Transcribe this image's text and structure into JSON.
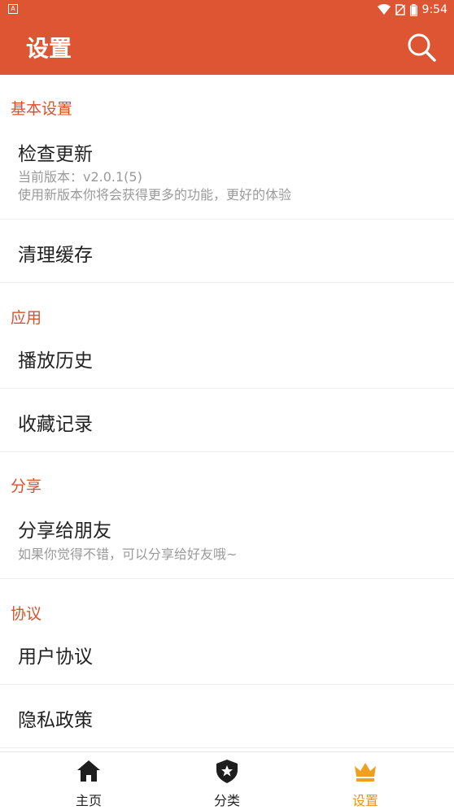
{
  "status_bar": {
    "notification_icon": "A",
    "time": "9:54",
    "icons": [
      "wifi-icon",
      "no-sim-icon",
      "battery-icon"
    ]
  },
  "app_bar": {
    "title": "设置",
    "search_icon": "search-icon",
    "background": "#dd5533"
  },
  "sections": [
    {
      "header": "基本设置",
      "items": [
        {
          "title": "检查更新",
          "subtitle_1": "当前版本：v2.0.1(5)",
          "subtitle_2": "使用新版本你将会获得更多的功能，更好的体验"
        },
        {
          "title": "清理缓存"
        }
      ]
    },
    {
      "header": "应用",
      "items": [
        {
          "title": "播放历史"
        },
        {
          "title": "收藏记录"
        }
      ]
    },
    {
      "header": "分享",
      "items": [
        {
          "title": "分享给朋友",
          "subtitle_1": "如果你觉得不错，可以分享给好友哦~"
        }
      ]
    },
    {
      "header": "协议",
      "items": [
        {
          "title": "用户协议"
        },
        {
          "title": "隐私政策"
        }
      ]
    }
  ],
  "bottom_nav": {
    "items": [
      {
        "label": "主页",
        "icon": "home-icon",
        "active": false
      },
      {
        "label": "分类",
        "icon": "shield-star-icon",
        "active": false
      },
      {
        "label": "设置",
        "icon": "crown-icon",
        "active": true
      }
    ]
  },
  "colors": {
    "accent": "#dd5533",
    "section_header": "#d9522b",
    "active_tab": "#e8941a"
  }
}
